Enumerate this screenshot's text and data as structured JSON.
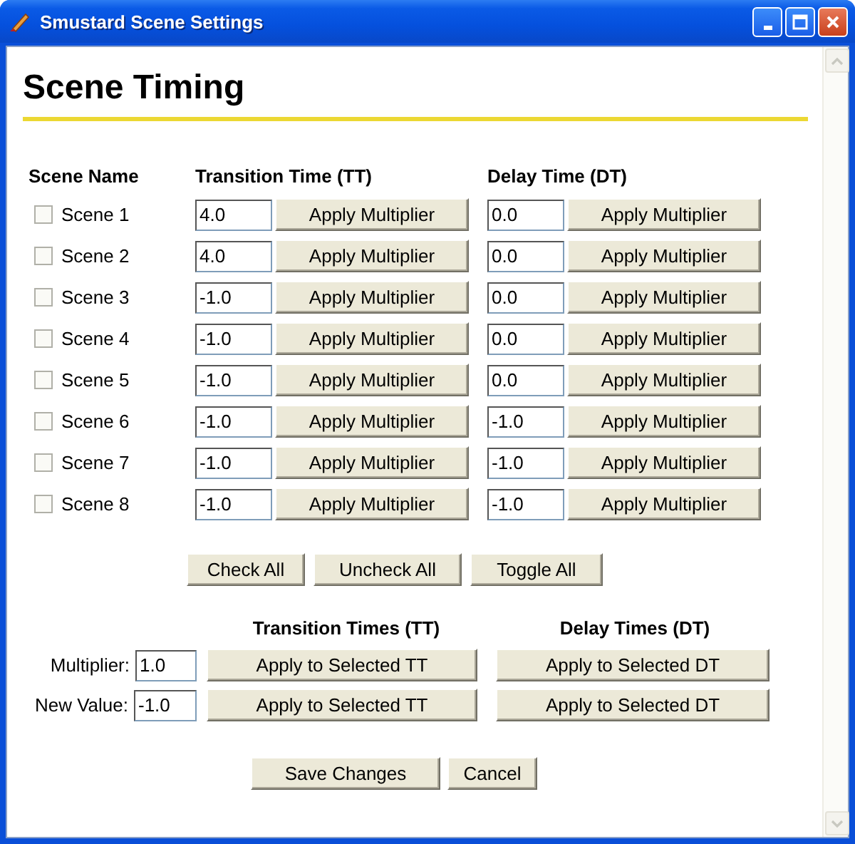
{
  "window": {
    "title": "Smustard Scene Settings"
  },
  "heading": "Scene Timing",
  "table": {
    "columns": [
      "Scene Name",
      "Transition Time (TT)",
      "Delay Time (DT)"
    ],
    "rows": [
      {
        "name": "Scene 1",
        "checked": false,
        "tt": "4.0",
        "tt_button": "Apply Multiplier",
        "dt": "0.0",
        "dt_button": "Apply Multiplier"
      },
      {
        "name": "Scene 2",
        "checked": false,
        "tt": "4.0",
        "tt_button": "Apply Multiplier",
        "dt": "0.0",
        "dt_button": "Apply Multiplier"
      },
      {
        "name": "Scene 3",
        "checked": false,
        "tt": "-1.0",
        "tt_button": "Apply Multiplier",
        "dt": "0.0",
        "dt_button": "Apply Multiplier"
      },
      {
        "name": "Scene 4",
        "checked": false,
        "tt": "-1.0",
        "tt_button": "Apply Multiplier",
        "dt": "0.0",
        "dt_button": "Apply Multiplier"
      },
      {
        "name": "Scene 5",
        "checked": false,
        "tt": "-1.0",
        "tt_button": "Apply Multiplier",
        "dt": "0.0",
        "dt_button": "Apply Multiplier"
      },
      {
        "name": "Scene 6",
        "checked": false,
        "tt": "-1.0",
        "tt_button": "Apply Multiplier",
        "dt": "-1.0",
        "dt_button": "Apply Multiplier"
      },
      {
        "name": "Scene 7",
        "checked": false,
        "tt": "-1.0",
        "tt_button": "Apply Multiplier",
        "dt": "-1.0",
        "dt_button": "Apply Multiplier"
      },
      {
        "name": "Scene 8",
        "checked": false,
        "tt": "-1.0",
        "tt_button": "Apply Multiplier",
        "dt": "-1.0",
        "dt_button": "Apply Multiplier"
      }
    ]
  },
  "selection_buttons": [
    "Check All",
    "Uncheck All",
    "Toggle All"
  ],
  "bulk": {
    "columns": [
      "Transition Times (TT)",
      "Delay Times (DT)"
    ],
    "rows": [
      {
        "label": "Multiplier:",
        "value": "1.0",
        "tt_button": "Apply to Selected TT",
        "dt_button": "Apply to Selected DT"
      },
      {
        "label": "New Value:",
        "value": "-1.0",
        "tt_button": "Apply to Selected TT",
        "dt_button": "Apply to Selected DT"
      }
    ]
  },
  "buttons": [
    "Save Changes",
    "Cancel"
  ]
}
